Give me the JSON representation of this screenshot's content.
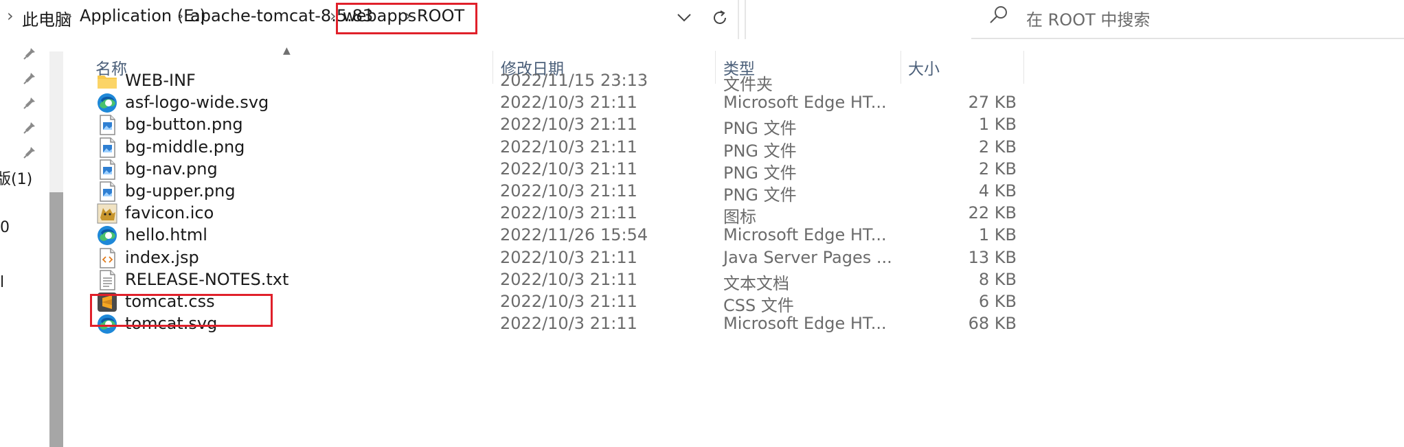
{
  "breadcrumb": {
    "items": [
      "此电脑",
      "Application (E:)",
      "apache-tomcat-8.5.83",
      "webapps",
      "ROOT"
    ],
    "separator": "›"
  },
  "search": {
    "placeholder": "在 ROOT 中搜索"
  },
  "nav": {
    "pinned_count": 5,
    "partial_items": [
      "版(1)",
      "0",
      "l"
    ]
  },
  "columns": {
    "name": "名称",
    "date": "修改日期",
    "type": "类型",
    "size": "大小"
  },
  "files": [
    {
      "name": "WEB-INF",
      "date": "2022/11/15 23:13",
      "type": "文件夹",
      "size": "",
      "icon": "folder-icon"
    },
    {
      "name": "asf-logo-wide.svg",
      "date": "2022/10/3 21:11",
      "type": "Microsoft Edge HT...",
      "size": "27 KB",
      "icon": "edge-icon"
    },
    {
      "name": "bg-button.png",
      "date": "2022/10/3 21:11",
      "type": "PNG 文件",
      "size": "1 KB",
      "icon": "image-file-icon"
    },
    {
      "name": "bg-middle.png",
      "date": "2022/10/3 21:11",
      "type": "PNG 文件",
      "size": "2 KB",
      "icon": "image-file-icon"
    },
    {
      "name": "bg-nav.png",
      "date": "2022/10/3 21:11",
      "type": "PNG 文件",
      "size": "2 KB",
      "icon": "image-file-icon"
    },
    {
      "name": "bg-upper.png",
      "date": "2022/10/3 21:11",
      "type": "PNG 文件",
      "size": "4 KB",
      "icon": "image-file-icon"
    },
    {
      "name": "favicon.ico",
      "date": "2022/10/3 21:11",
      "type": "图标",
      "size": "22 KB",
      "icon": "tomcat-favicon-icon"
    },
    {
      "name": "hello.html",
      "date": "2022/11/26 15:54",
      "type": "Microsoft Edge HT...",
      "size": "1 KB",
      "icon": "edge-icon"
    },
    {
      "name": "index.jsp",
      "date": "2022/10/3 21:11",
      "type": "Java Server Pages ...",
      "size": "13 KB",
      "icon": "code-file-icon"
    },
    {
      "name": "RELEASE-NOTES.txt",
      "date": "2022/10/3 21:11",
      "type": "文本文档",
      "size": "8 KB",
      "icon": "text-file-icon"
    },
    {
      "name": "tomcat.css",
      "date": "2022/10/3 21:11",
      "type": "CSS 文件",
      "size": "6 KB",
      "icon": "sublime-css-icon"
    },
    {
      "name": "tomcat.svg",
      "date": "2022/10/3 21:11",
      "type": "Microsoft Edge HT...",
      "size": "68 KB",
      "icon": "edge-icon"
    }
  ],
  "highlight_color": "#e0202a",
  "header_text_color": "#4c607a"
}
